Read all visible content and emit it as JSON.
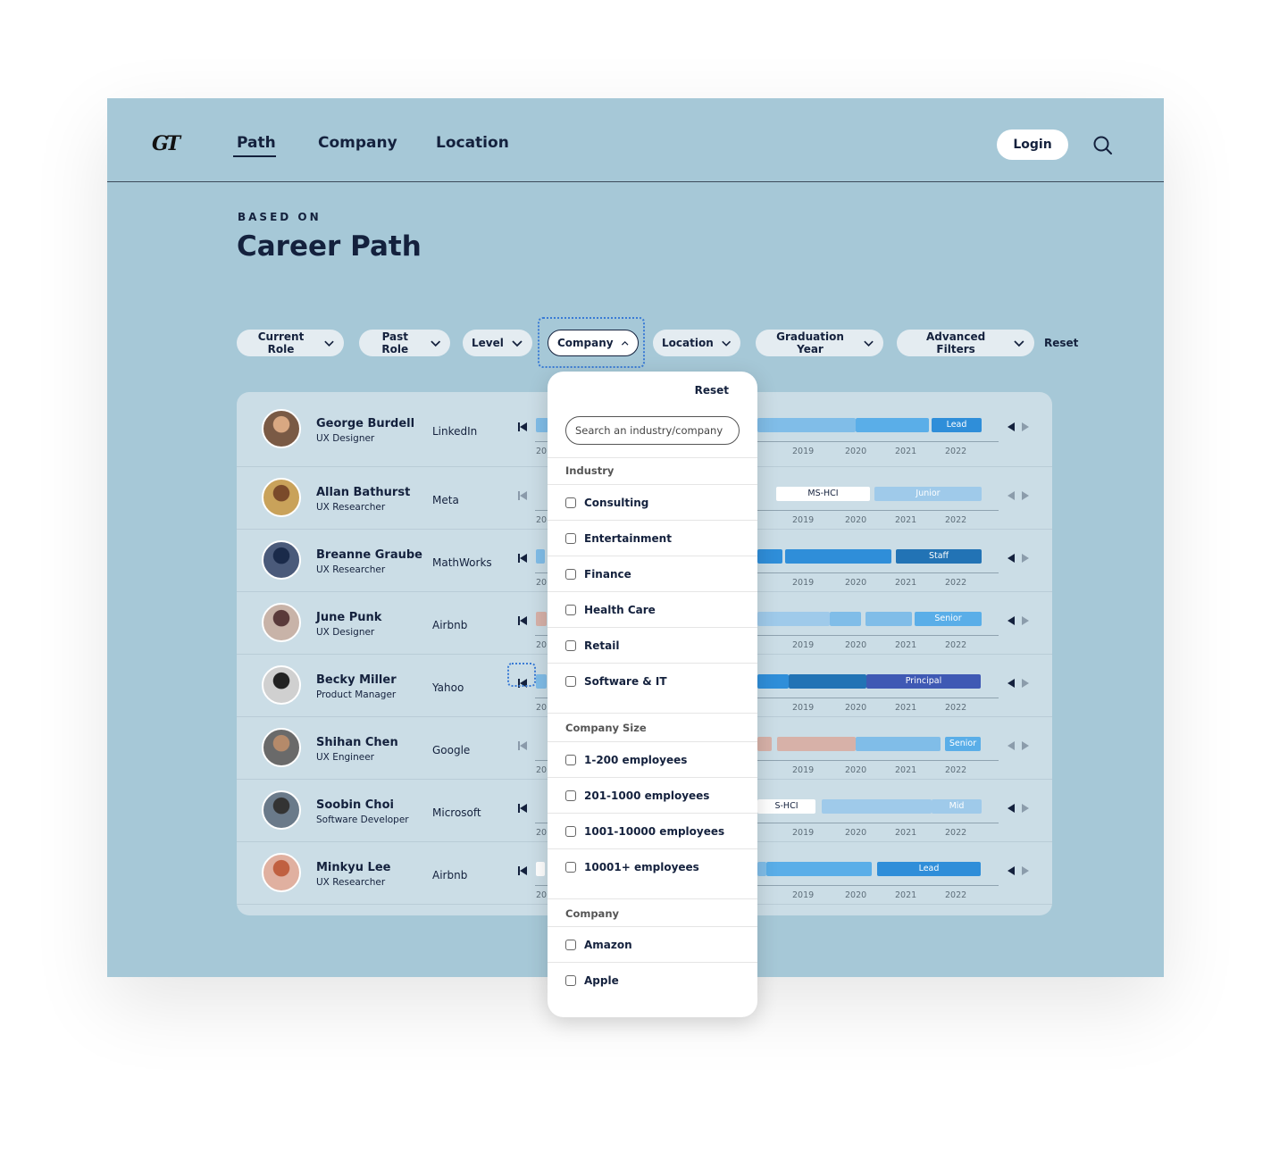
{
  "nav": {
    "logo": "GT",
    "links": [
      "Path",
      "Company",
      "Location"
    ],
    "login": "Login",
    "search_icon": "search-icon"
  },
  "header": {
    "eyebrow": "BASED ON",
    "title": "Career Path"
  },
  "filters": {
    "items": [
      "Current Role",
      "Past Role",
      "Level",
      "Company",
      "Location",
      "Graduation Year",
      "Advanced Filters"
    ],
    "active": "Company",
    "reset": "Reset"
  },
  "years": [
    "20",
    "2019",
    "2020",
    "2021",
    "2022"
  ],
  "people": [
    {
      "name": "George Burdell",
      "role": "UX Designer",
      "company": "LinkedIn",
      "tag": "Lead"
    },
    {
      "name": "Allan Bathurst",
      "role": "UX Researcher",
      "company": "Meta",
      "tag": "Junior",
      "edu": "MS-HCI"
    },
    {
      "name": "Breanne Graube",
      "role": "UX Researcher",
      "company": "MathWorks",
      "tag": "Staff"
    },
    {
      "name": "June Punk",
      "role": "UX Designer",
      "company": "Airbnb",
      "tag": "Senior"
    },
    {
      "name": "Becky Miller",
      "role": "Product Manager",
      "company": "Yahoo",
      "tag": "Principal"
    },
    {
      "name": "Shihan Chen",
      "role": "UX Engineer",
      "company": "Google",
      "tag": "Senior"
    },
    {
      "name": "Soobin Choi",
      "role": "Software Developer",
      "company": "Microsoft",
      "tag": "Mid",
      "edu": "S-HCI"
    },
    {
      "name": "Minkyu Lee",
      "role": "UX Researcher",
      "company": "Airbnb",
      "tag": "Lead"
    }
  ],
  "colors": {
    "background": "#a6c8d7",
    "light_blue": "#80bde8",
    "mid_blue": "#5aaee8",
    "blue": "#2f8ed9",
    "dark_blue": "#2273b5",
    "indigo": "#3f59b4",
    "salmon": "#d7b1a8",
    "pale_blue": "#9fcaea"
  },
  "dropdown": {
    "reset": "Reset",
    "search_placeholder": "Search an industry/company",
    "industry_title": "Industry",
    "industry": [
      "Consulting",
      "Entertainment",
      "Finance",
      "Health Care",
      "Retail",
      "Software & IT"
    ],
    "size_title": "Company Size",
    "sizes": [
      "1-200 employees",
      "201-1000 employees",
      "1001-10000 employees",
      "10001+ employees"
    ],
    "company_title": "Company",
    "companies": [
      "Amazon",
      "Apple"
    ]
  }
}
